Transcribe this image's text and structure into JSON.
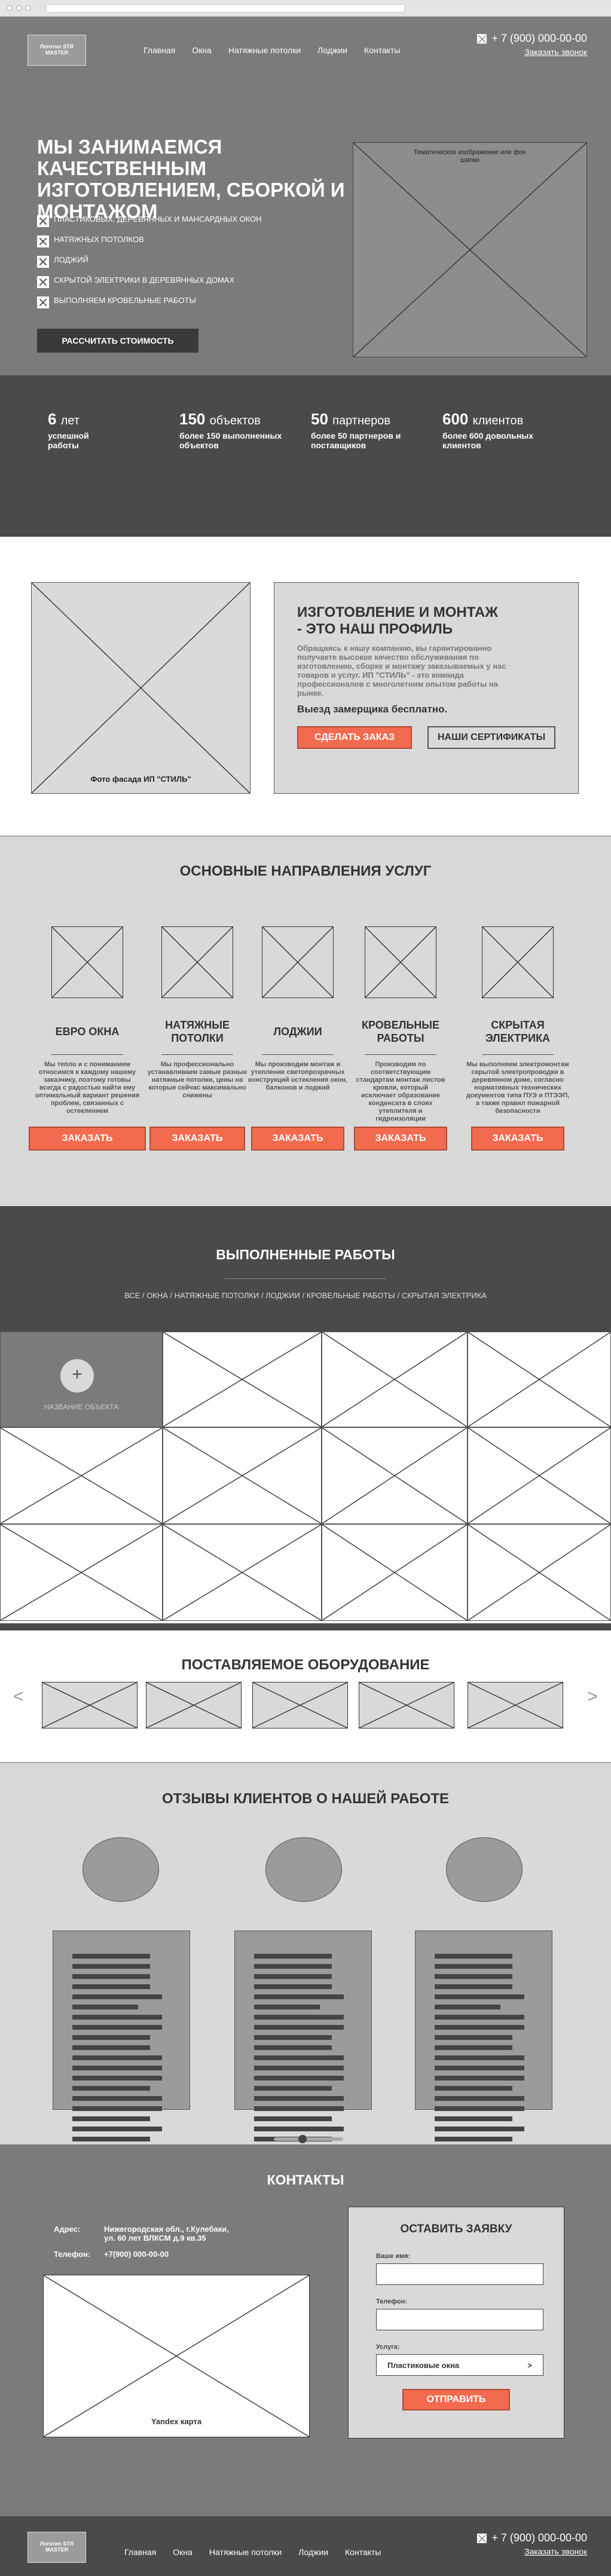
{
  "header": {
    "logo": "Логотип STR MASTER",
    "nav": [
      "Главная",
      "Окна",
      "Натяжные потолки",
      "Лоджии",
      "Контакты"
    ],
    "phone": "+ 7 (900) 000-00-00",
    "callback": "Заказать звонок"
  },
  "hero": {
    "title": "МЫ ЗАНИМАЕМСЯ КАЧЕСТВЕННЫМ ИЗГОТОВЛЕНИЕМ, СБОРКОЙ И МОНТАЖОМ",
    "features": [
      "ПЛАСТИКОВЫХ, ДЕРЕВЯННЫХ И МАНСАРДНЫХ ОКОН",
      "НАТЯЖНЫХ ПОТОЛКОВ",
      "ЛОДЖИЙ",
      "СКРЫТОЙ ЭЛЕКТРИКИ В ДЕРЕВЯННЫХ ДОМАХ",
      "ВЫПОЛНЯЕМ КРОВЕЛЬНЫЕ РАБОТЫ"
    ],
    "button": "РАССЧИТАТЬ СТОИМОСТЬ",
    "image_caption": "Тематическое изображение или фон шапки"
  },
  "stats": [
    {
      "num": "6",
      "unit": "лет",
      "desc": "успешной работы"
    },
    {
      "num": "150",
      "unit": "объектов",
      "desc": "более 150 выполненных объектов"
    },
    {
      "num": "50",
      "unit": "партнеров",
      "desc": "более 50 партнеров и поставщиков"
    },
    {
      "num": "600",
      "unit": "клиентов",
      "desc": "более 600 довольных клиентов"
    }
  ],
  "profile": {
    "image_caption": "Фото фасада ИП \"СТИЛЬ\"",
    "title": "ИЗГОТОВЛЕНИЕ И МОНТАЖ - ЭТО НАШ ПРОФИЛЬ",
    "text": "Обращаясь к нашу компанию, вы гарантированно получаете высокое качество обслуживания по изготовлению, сборке и монтажу заказываемых у нас товаров и услуг. ИП \"СТИЛЬ\" - это команда профессионалов с многолетним опытом работы на рынке.",
    "strong": "Выезд замерщика бесплатно.",
    "order_btn": "СДЕЛАТЬ ЗАКАЗ",
    "cert_btn": "НАШИ СЕРТИФИКАТЫ"
  },
  "services": {
    "title": "ОСНОВНЫЕ НАПРАВЛЕНИЯ УСЛУГ",
    "items": [
      {
        "name": "ЕВРО ОКНА",
        "desc": "Мы тепло и с пониманием относимся к каждому нашему заказчику, поэтому готовы всегда с радостью найти ему оптимальный вариант решения проблем, связанных с остеклением"
      },
      {
        "name": "НАТЯЖНЫЕ ПОТОЛКИ",
        "desc": "Мы профессионально устанавливаем самые разные натяжные потолки, цены на которые сейчас максимально снижены"
      },
      {
        "name": "ЛОДЖИИ",
        "desc": "Мы производим монтаж и утепление светопрозрачных конструкций остекления окон, балконов и лоджий"
      },
      {
        "name": "КРОВЕЛЬНЫЕ РАБОТЫ",
        "desc": "Производим по соответствующим стандартам монтаж листов кровли, который исключает образование конденсата в слоях утеплителя и гидроизоляции"
      },
      {
        "name": "СКРЫТАЯ ЭЛЕКТРИКА",
        "desc": "Мы выполняем электромонтаж скрытой электропроводки в деревянном доме, согласно нормативных технических документов типа ПУЭ и ПТЭЭП, а также правил пожарной безопасности"
      }
    ],
    "order_label": "ЗАКАЗАТЬ"
  },
  "works": {
    "title": "ВЫПОЛНЕННЫЕ РАБОТЫ",
    "filters": "ВСЕ / ОКНА / НАТЯЖНЫЕ ПОТОЛКИ / ЛОДЖИИ / КРОВЕЛЬНЫЕ РАБОТЫ / СКРЫТАЯ ЭЛЕКТРИКА",
    "active_plus": "+",
    "active_label": "НАЗВАНИЕ ОБЪЕКТА"
  },
  "equipment": {
    "title": "ПОСТАВЛЯЕМОЕ ОБОРУДОВАНИЕ",
    "prev": "<",
    "next": ">"
  },
  "reviews": {
    "title": "ОТЗЫВЫ КЛИЕНТОВ О НАШЕЙ РАБОТЕ",
    "slider_position": 0.4
  },
  "contacts": {
    "title": "КОНТАКТЫ",
    "address_label": "Адрес:",
    "address": "Нижегородская обл., г.Кулебаки, ул. 60 лет ВЛКСМ д.9 кв.35",
    "phone_label": "Телефон:",
    "phone": "+7(900) 000-00-00",
    "map_caption": "Yandex карта"
  },
  "form": {
    "title": "ОСТАВИТЬ ЗАЯВКУ",
    "name_label": "Ваше имя:",
    "phone_label": "Телефон:",
    "service_label": "Услуга:",
    "service_value": "Пластиковые окна",
    "select_arrow": ">",
    "submit": "ОТПРАВИТЬ"
  },
  "colors": {
    "accent": "#f26b4f",
    "dark": "#4a4a4a",
    "mid": "#7b7b7b",
    "light": "#d9d9d9"
  }
}
